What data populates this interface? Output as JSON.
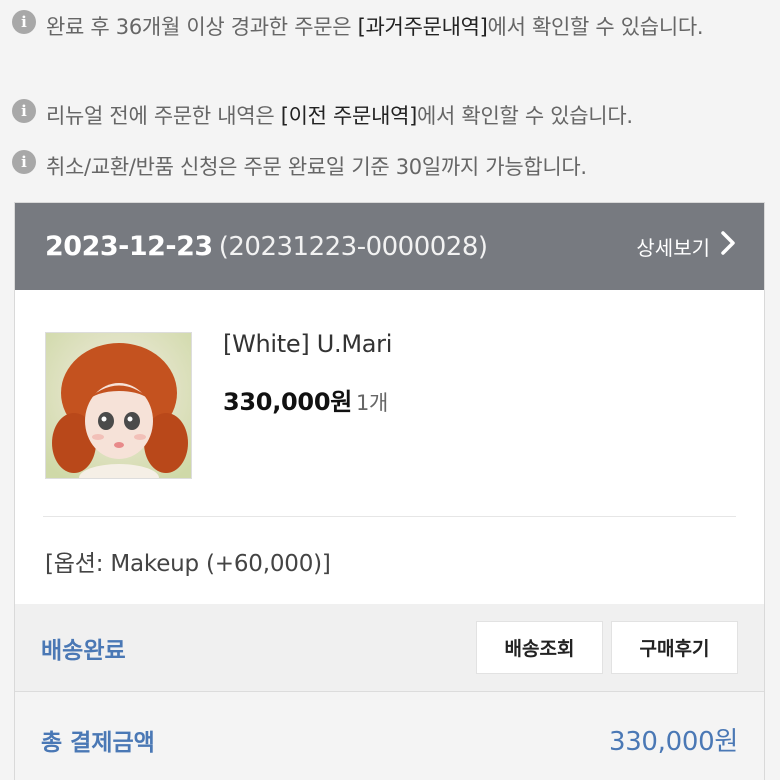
{
  "notices": [
    {
      "icon": "info-icon",
      "before": "완료 후 36개월 이상 경과한 주문은 ",
      "highlight": "[과거주문내역]",
      "after": "에서 확인할 수 있습니다."
    },
    {
      "icon": "info-icon",
      "before": "리뉴얼 전에 주문한 내역은 ",
      "highlight": "[이전 주문내역]",
      "after": "에서 확인할 수 있습니다."
    },
    {
      "icon": "info-icon",
      "before": "취소/교환/반품 신청은 주문 완료일 기준 30일까지 가능합니다.",
      "highlight": "",
      "after": ""
    }
  ],
  "order": {
    "date": "2023-12-23",
    "order_no": "(20231223-0000028)",
    "detail_label": "상세보기",
    "detail_icon": "chevron-right-icon",
    "product": {
      "name": "[White] U.Mari",
      "price": "330,000원",
      "qty": "1개",
      "image": "doll-thumbnail"
    },
    "option": "[옵션: Makeup (+60,000)]",
    "status": "배송완료",
    "buttons": {
      "track": "배송조회",
      "review": "구매후기"
    },
    "total_label": "총 결제금액",
    "total_value": "330,000원"
  },
  "colors": {
    "header_bg": "#777a80",
    "accent_blue": "#4a78b5",
    "page_bg": "#f4f4f4"
  }
}
